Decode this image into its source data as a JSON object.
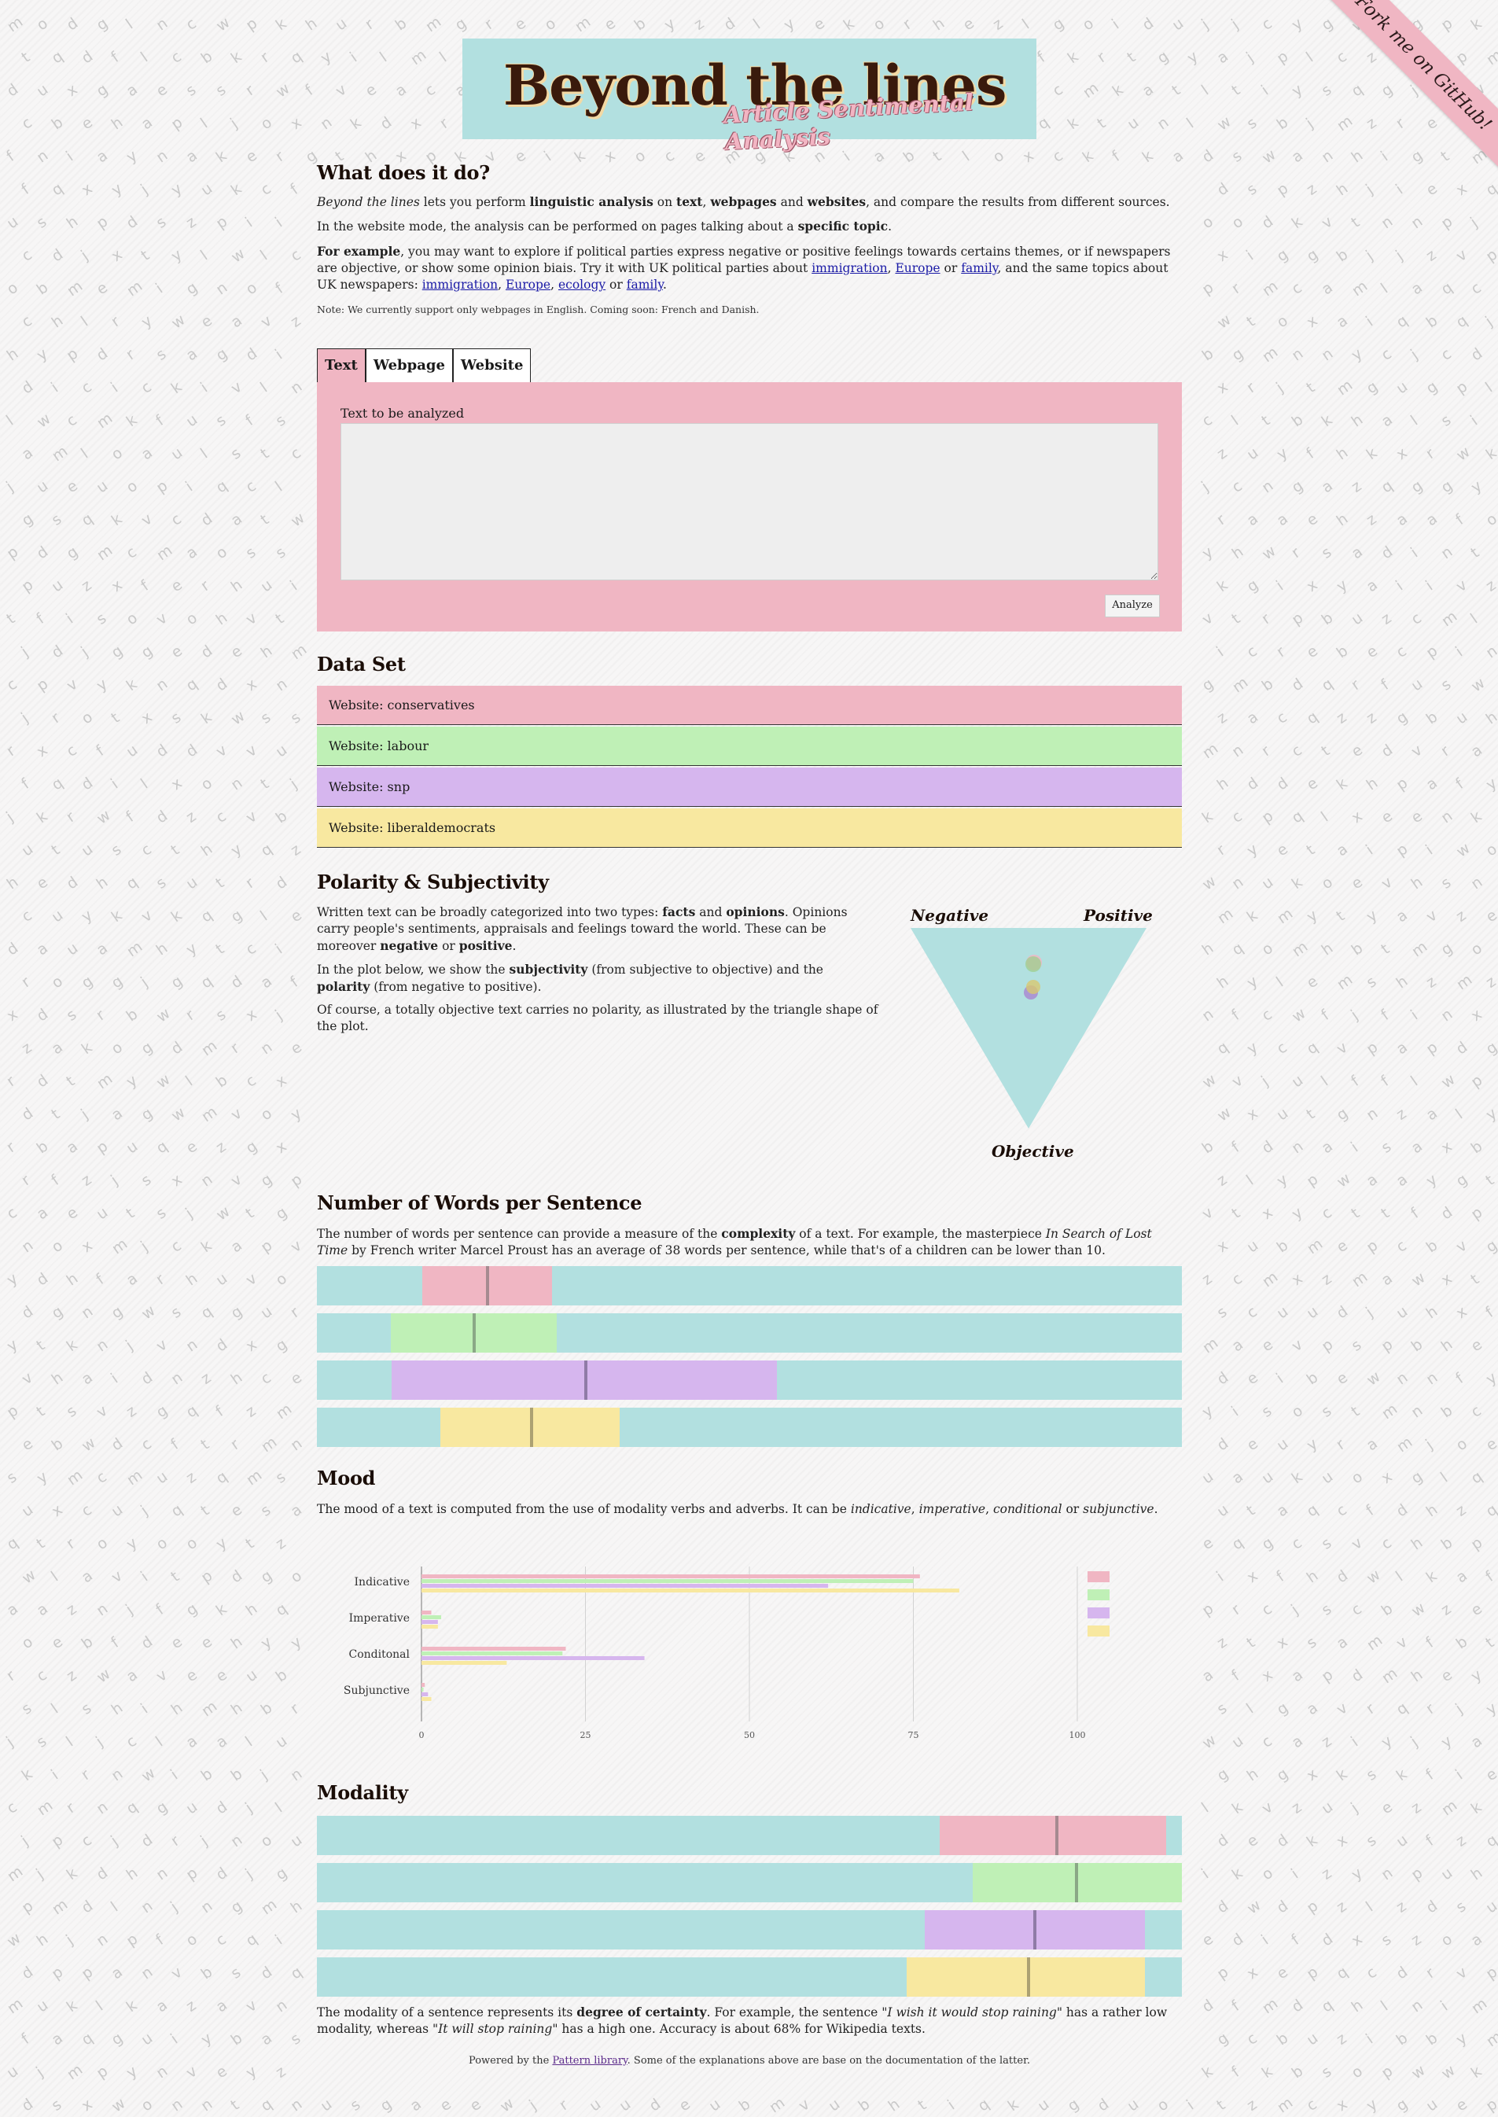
{
  "ribbon": {
    "label": "Fork me on GitHub!"
  },
  "header": {
    "title": "Beyond the lines",
    "subtitle": "Article Sentimental Analysis"
  },
  "intro": {
    "heading": "What does it do?",
    "p1_em": "Beyond the lines",
    "p1_a": " lets you perform ",
    "p1_b1": "linguistic analysis",
    "p1_c": " on ",
    "p1_b2": "text",
    "p1_d": ", ",
    "p1_b3": "webpages",
    "p1_e": " and ",
    "p1_b4": "websites",
    "p1_f": ", and compare the results from different sources.",
    "p2_a": "In the website mode, the analysis can be performed on pages talking about a ",
    "p2_b": "specific topic",
    "p2_c": ".",
    "p3_b": "For example",
    "p3_a": ", you may want to explore if political parties express negative or positive feelings towards certains themes, or if newspapers are objective, or show some opinion biais. Try it with UK political parties about ",
    "links": [
      "immigration",
      "Europe",
      "family",
      "immigration",
      "Europe",
      "ecology",
      "family"
    ],
    "p3_or1": " or ",
    "p3_mid": ", and the same topics about UK newspapers: ",
    "p3_comma": ", ",
    "p3_or2": " or ",
    "p3_end": ".",
    "note": "Note: We currently support only webpages in English. Coming soon: French and Danish."
  },
  "tabs": [
    "Text",
    "Webpage",
    "Website"
  ],
  "panel": {
    "label": "Text to be analyzed",
    "textarea_value": "",
    "button": "Analyze"
  },
  "dataset": {
    "heading": "Data Set",
    "rows": [
      {
        "label": "Website: conservatives",
        "color": "#f0b6c3"
      },
      {
        "label": "Website: labour",
        "color": "#bff0b6"
      },
      {
        "label": "Website: snp",
        "color": "#d6b6ee"
      },
      {
        "label": "Website: liberaldemocrats",
        "color": "#f8e8a0"
      }
    ]
  },
  "polarity": {
    "heading": "Polarity & Subjectivity",
    "p1_a": "Written text can be broadly categorized into two types: ",
    "p1_b1": "facts",
    "p1_c": " and ",
    "p1_b2": "opinions",
    "p1_d": ". Opinions carry people's sentiments, appraisals and feelings toward the world. These can be moreover ",
    "p1_b3": "negative",
    "p1_e": " or ",
    "p1_b4": "positive",
    "p1_f": ".",
    "p2_a": "In the plot below, we show the ",
    "p2_b1": "subjectivity",
    "p2_c": " (from subjective to objective) and the ",
    "p2_b2": "polarity",
    "p2_d": " (from negative to positive).",
    "p3": "Of course, a totally objective text carries no polarity, as illustrated by the triangle shape of the plot.",
    "labels": {
      "negative": "Negative",
      "positive": "Positive",
      "objective": "Objective"
    }
  },
  "words": {
    "heading": "Number of Words per Sentence",
    "p_a": "The number of words per sentence can provide a measure of the ",
    "p_b": "complexity",
    "p_c": " of a text. For example, the masterpiece ",
    "p_em": "In Search of Lost Time",
    "p_d": " by French writer Marcel Proust has an average of 38 words per sentence, while that's of a children can be lower than 10.",
    "bars": [
      {
        "from": 0.122,
        "to": 0.272,
        "mark": 0.197,
        "color": "#f0b6c3",
        "mark_color": "#a68a90"
      },
      {
        "from": 0.085,
        "to": 0.277,
        "mark": 0.182,
        "color": "#bff0b6",
        "mark_color": "#8aa886"
      },
      {
        "from": 0.086,
        "to": 0.532,
        "mark": 0.311,
        "color": "#d6b6ee",
        "mark_color": "#8f7ba6"
      },
      {
        "from": 0.143,
        "to": 0.35,
        "mark": 0.248,
        "color": "#f8e8a0",
        "mark_color": "#aca172"
      }
    ]
  },
  "mood": {
    "heading": "Mood",
    "p_a": "The mood of a text is computed from the use of modality verbs and adverbs. It can be ",
    "p_em1": "indicative",
    "p_sep1": ", ",
    "p_em2": "imperative",
    "p_sep2": ", ",
    "p_em3": "conditional",
    "p_or": " or ",
    "p_em4": "subjunctive",
    "p_end": "."
  },
  "chart_data": {
    "type": "bar",
    "orientation": "horizontal",
    "categories": [
      "Indicative",
      "Imperative",
      "Conditonal",
      "Subjunctive"
    ],
    "series": [
      {
        "color": "#f0b6c3",
        "values": [
          76,
          1.5,
          22,
          0.5
        ]
      },
      {
        "color": "#bff0b6",
        "values": [
          75,
          3,
          21.5,
          0.3
        ]
      },
      {
        "color": "#d6b6ee",
        "values": [
          62,
          2.5,
          34,
          1
        ]
      },
      {
        "color": "#f8e8a0",
        "values": [
          82,
          2.5,
          13,
          1.5
        ]
      }
    ],
    "xlim": [
      0,
      100
    ],
    "xticks": [
      0,
      25,
      50,
      75,
      100
    ],
    "grid": true,
    "legend": "right"
  },
  "modality": {
    "heading": "Modality",
    "p_a": "The modality of a sentence represents its ",
    "p_b": "degree of certainty",
    "p_c": ". For example, the sentence \"",
    "p_em1": "I wish it would stop raining",
    "p_d": "\" has a rather low modality, whereas \"",
    "p_em2": "It will stop raining",
    "p_e": "\" has a high one. Accuracy is about 68% for Wikipedia texts.",
    "bars": [
      {
        "from": 0.72,
        "to": 0.982,
        "mark": 0.855,
        "color": "#f0b6c3",
        "mark_color": "#a68a90"
      },
      {
        "from": 0.758,
        "to": 1.0,
        "mark": 0.878,
        "color": "#bff0b6",
        "mark_color": "#8aa886"
      },
      {
        "from": 0.703,
        "to": 0.957,
        "mark": 0.83,
        "color": "#d6b6ee",
        "mark_color": "#8f7ba6"
      },
      {
        "from": 0.682,
        "to": 0.957,
        "mark": 0.823,
        "color": "#f8e8a0",
        "mark_color": "#aca172"
      }
    ]
  },
  "footer": {
    "a": "Powered by the ",
    "link": "Pattern library",
    "b": ". Some of the explanations above are base on the documentation of the latter."
  }
}
